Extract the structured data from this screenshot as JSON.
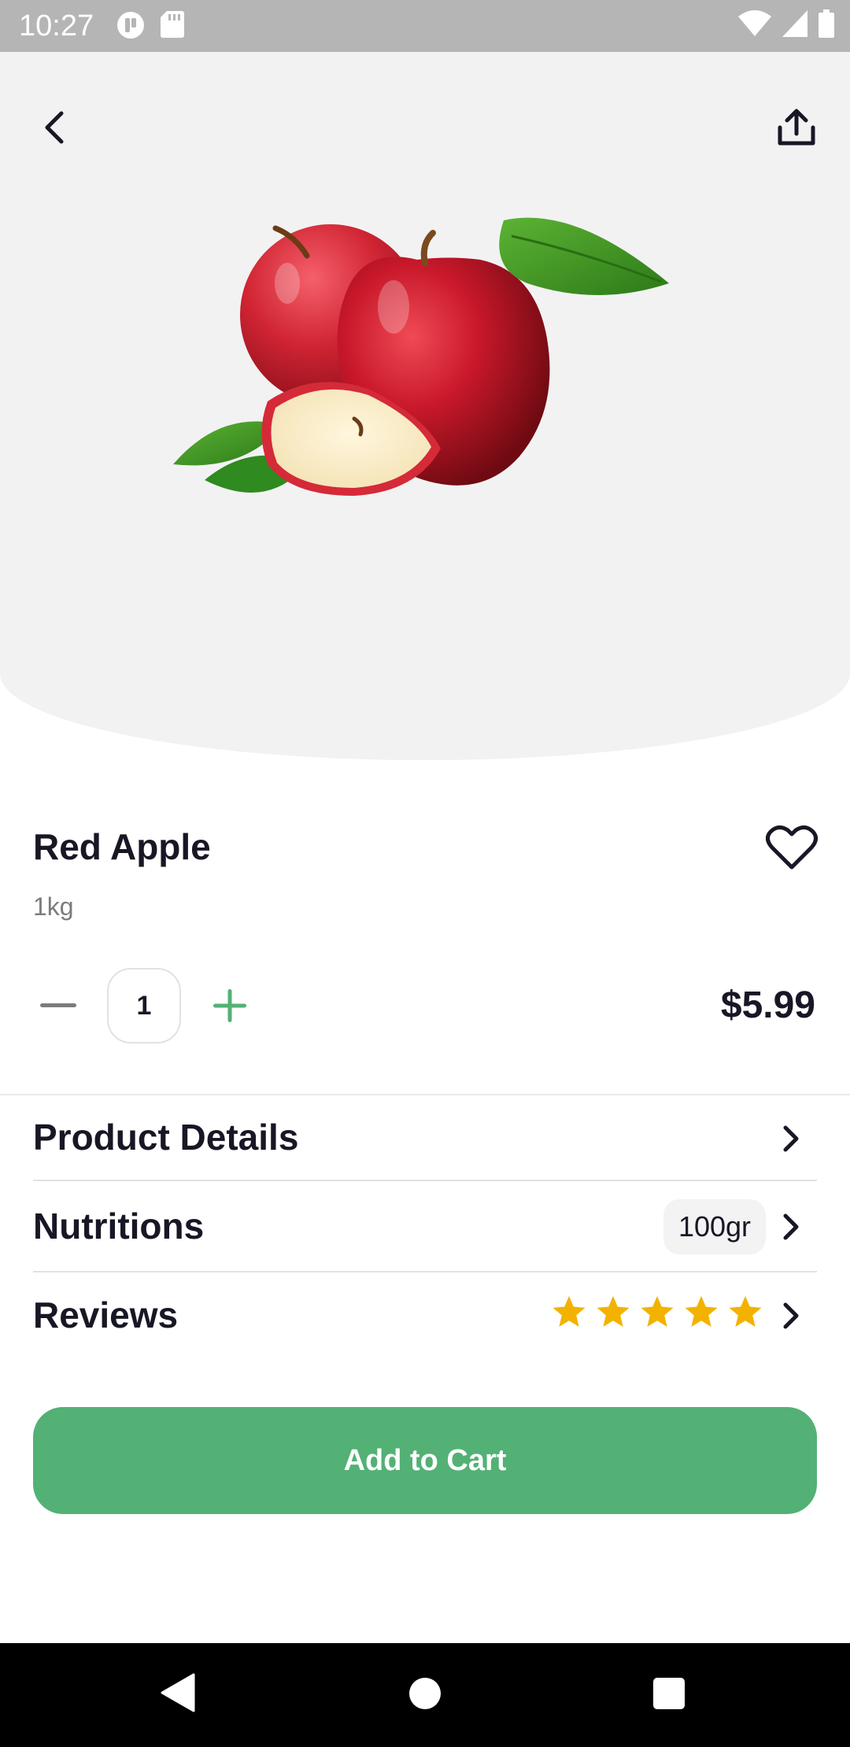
{
  "status_bar": {
    "time": "10:27",
    "icons": [
      "app-notification-icon",
      "sd-card-icon",
      "wifi-icon",
      "signal-icon",
      "battery-icon"
    ]
  },
  "header": {
    "back_icon": "chevron-left-icon",
    "share_icon": "share-icon"
  },
  "product": {
    "name": "Red Apple",
    "unit": "1kg",
    "price": "$5.99",
    "quantity": "1",
    "favorite_icon": "heart-outline-icon",
    "image": "red-apples-illustration"
  },
  "sections": [
    {
      "title": "Product Details"
    },
    {
      "title": "Nutritions",
      "badge": "100gr"
    },
    {
      "title": "Reviews",
      "rating": 5,
      "rating_max": 5
    }
  ],
  "cta": {
    "label": "Add to Cart"
  },
  "colors": {
    "accent": "#53B175",
    "star": "#F3B200",
    "hero_bg": "#F2F2F3",
    "text": "#181725",
    "muted": "#7C7C7C"
  }
}
